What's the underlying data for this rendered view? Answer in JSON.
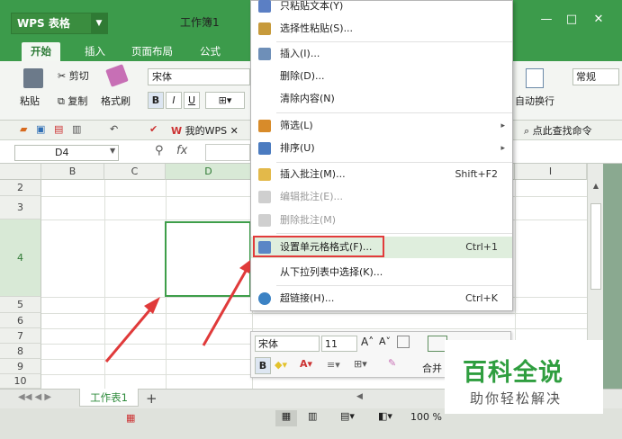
{
  "window": {
    "app_name": "WPS 表格",
    "doc_title": "工作簿1",
    "minimize": "—",
    "maximize": "□",
    "close": "✕"
  },
  "tabs": [
    "开始",
    "插入",
    "页面布局",
    "公式"
  ],
  "ribbon": {
    "paste": "粘贴",
    "cut": "剪切",
    "copy": "复制",
    "format_painter": "格式刷",
    "font_name": "宋体",
    "bold": "B",
    "italic": "I",
    "underline": "U",
    "wrap_text": "自动换行",
    "number_format": "常规"
  },
  "quickbar": {
    "my_wps": "我的WPS",
    "find_cmd": "点此查找命令"
  },
  "formula_bar": {
    "name_box": "D4",
    "fx": "fx"
  },
  "grid": {
    "columns": [
      "B",
      "C",
      "D",
      "I"
    ],
    "rows": [
      "2",
      "3",
      "4",
      "5",
      "6",
      "7",
      "8",
      "9",
      "10"
    ]
  },
  "context_menu": {
    "items": [
      {
        "label": "只粘贴文本(Y)",
        "shortcut": "",
        "disabled": false
      },
      {
        "label": "选择性粘贴(S)...",
        "shortcut": "",
        "disabled": false
      },
      {
        "label": "插入(I)...",
        "shortcut": "",
        "disabled": false
      },
      {
        "label": "删除(D)...",
        "shortcut": "",
        "disabled": false
      },
      {
        "label": "清除内容(N)",
        "shortcut": "",
        "disabled": false
      },
      {
        "label": "筛选(L)",
        "shortcut": "",
        "disabled": false
      },
      {
        "label": "排序(U)",
        "shortcut": "",
        "disabled": false
      },
      {
        "label": "插入批注(M)...",
        "shortcut": "Shift+F2",
        "disabled": false
      },
      {
        "label": "编辑批注(E)...",
        "shortcut": "",
        "disabled": true
      },
      {
        "label": "删除批注(M)",
        "shortcut": "",
        "disabled": true
      },
      {
        "label": "设置单元格格式(F)...",
        "shortcut": "Ctrl+1",
        "disabled": false
      },
      {
        "label": "从下拉列表中选择(K)...",
        "shortcut": "",
        "disabled": false
      },
      {
        "label": "超链接(H)...",
        "shortcut": "Ctrl+K",
        "disabled": false
      }
    ]
  },
  "mini_toolbar": {
    "font_name": "宋体",
    "font_size": "11",
    "bold": "B",
    "merge": "合并"
  },
  "sheet": {
    "tab": "工作表1",
    "add": "+"
  },
  "status": {
    "zoom": "100 %"
  },
  "watermark": {
    "title": "百科全说",
    "subtitle": "助你轻松解决"
  },
  "colors": {
    "brand_green": "#3c9b4b",
    "highlight_red": "#e23b3b",
    "selection_green": "#3e9e4a",
    "arrow_red": "#e03a3a"
  }
}
